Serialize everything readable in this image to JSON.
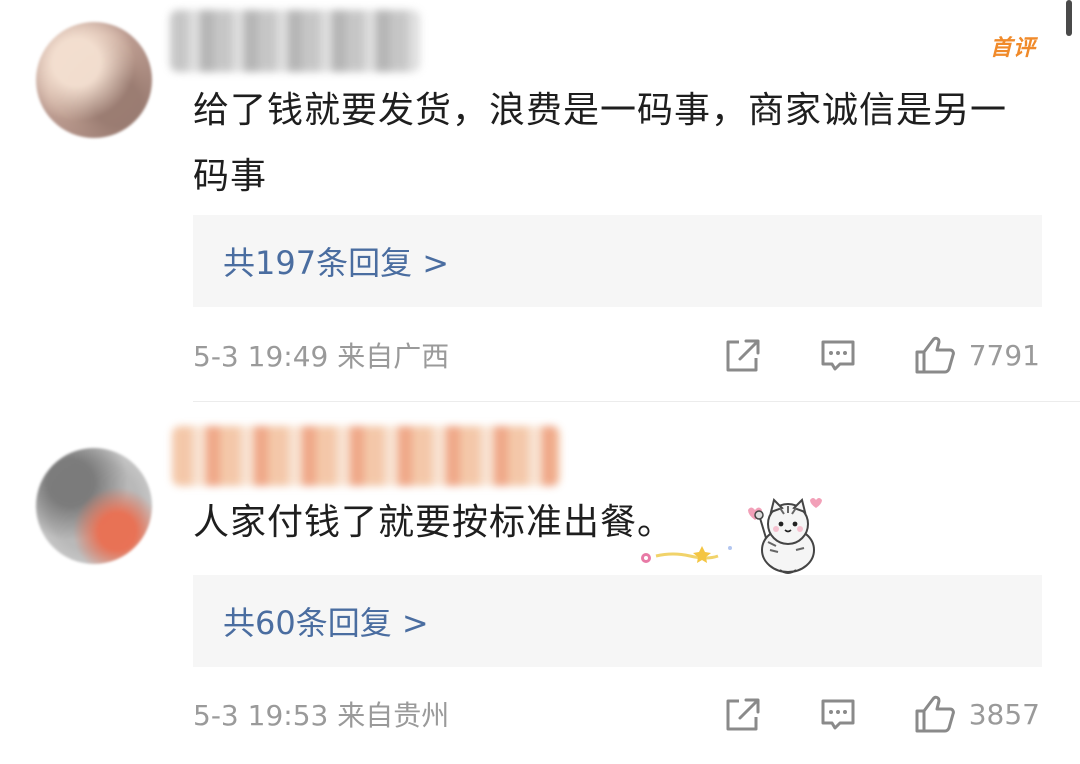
{
  "top_badge": "首评",
  "comments": [
    {
      "text": "给了钱就要发货，浪费是一码事，商家诚信是另一码事",
      "reply_link": "共197条回复 >",
      "meta": "5-3 19:49 来自广西",
      "likes": "7791"
    },
    {
      "text": "人家付钱了就要按标准出餐。",
      "reply_link": "共60条回复 >",
      "meta": "5-3 19:53 来自贵州",
      "likes": "3857"
    }
  ],
  "icons": {
    "share": "share-icon",
    "reply": "comment-icon",
    "like": "thumbs-up-icon",
    "sticker": "cat-sticker"
  },
  "colors": {
    "reply_link": "#4a6da0",
    "meta": "#9a9a9a",
    "badge": "#f08a2a",
    "reply_box_bg": "#f6f6f6"
  }
}
